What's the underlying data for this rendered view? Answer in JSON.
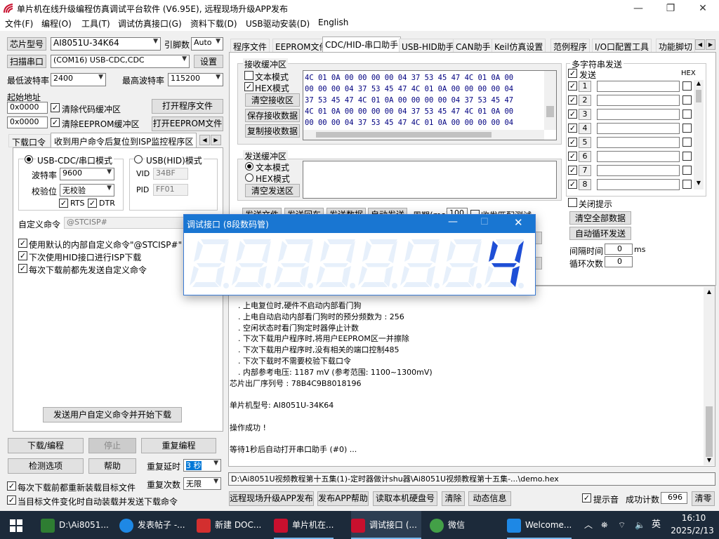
{
  "window": {
    "title": "单片机在线升级编程仿真调试平台软件 (V6.95E), 远程现场升级APP发布"
  },
  "menu": [
    "文件(F)",
    "编程(O)",
    "工具(T)",
    "调试仿真接口(G)",
    "资料下载(D)",
    "USB驱动安装(D)",
    "English"
  ],
  "left": {
    "chip_button": "芯片型号",
    "chip_value": "AI8051U-34K64",
    "pin_label": "引脚数",
    "pin_value": "Auto",
    "scan_button": "扫描串口",
    "port_value": "(COM16) USB-CDC,CDC",
    "settings_button": "设置",
    "min_baud_label": "最低波特率",
    "min_baud_value": "2400",
    "max_baud_label": "最高波特率",
    "max_baud_value": "115200",
    "start_addr_label": "起始地址",
    "addr1": "0x0000",
    "clear_code_label": "清除代码缓冲区",
    "open_prog_button": "打开程序文件",
    "addr2": "0x0000",
    "clear_eeprom_label": "清除EEPROM缓冲区",
    "open_eeprom_button": "打开EEPROM文件",
    "subtab1": "下载口令",
    "subtab2": "收到用户命令后复位到ISP监控程序区",
    "cdc_mode": "USB-CDC/串口模式",
    "hid_mode": "USB(HID)模式",
    "baud_label": "波特率",
    "baud_value": "9600",
    "parity_label": "校验位",
    "parity_value": "无校验",
    "rts_label": "RTS",
    "dtr_label": "DTR",
    "vid_label": "VID",
    "vid_value": "34BF",
    "pid_label": "PID",
    "pid_value": "FF01",
    "custom_cmd_label": "自定义命令",
    "custom_cmd_value": "@STCISP#",
    "opt1": "使用默认的内部自定义命令\"@STCISP#\"",
    "opt2": "下次使用HID接口进行ISP下载",
    "opt3": "每次下载前都先发送自定义命令",
    "send_custom_button": "发送用户自定义命令并开始下载",
    "download_button": "下载/编程",
    "stop_button": "停止",
    "reprogram_button": "重复编程",
    "check_button": "检测选项",
    "help_button": "帮助",
    "repeat_delay_label": "重复延时",
    "repeat_delay_value": "3 秒",
    "repeat_count_label": "重复次数",
    "repeat_count_value": "无限",
    "reload_label": "每次下载前都重新装载目标文件",
    "auto_label": "当目标文件变化时自动装载并发送下载命令"
  },
  "tabs": [
    "程序文件",
    "EEPROM文件",
    "CDC/HID-串口助手",
    "USB-HID助手",
    "CAN助手",
    "Keil仿真设置",
    "范例程序",
    "I/O口配置工具",
    "功能脚切"
  ],
  "receive": {
    "title": "接收缓冲区",
    "text_mode": "文本模式",
    "hex_mode": "HEX模式",
    "clear_button": "清空接收区",
    "save_button": "保存接收数据",
    "copy_button": "复制接收数据",
    "lines": [
      "4C 01 0A 00 00 00 00 04 37 53 45 47 4C 01 0A 00",
      "00 00 00 04 37 53 45 47 4C 01 0A 00 00 00 00 04",
      "37 53 45 47 4C 01 0A 00 00 00 00 04 37 53 45 47",
      "4C 01 0A 00 00 00 00 04 37 53 45 47 4C 01 0A 00",
      "00 00 00 04 37 53 45 47 4C 01 0A 00 00 00 00 04"
    ]
  },
  "send": {
    "title": "发送缓冲区",
    "text_mode": "文本模式",
    "hex_mode": "HEX模式",
    "clear_button": "清空发送区",
    "row_items": [
      "发送文件",
      "发送回车",
      "发送数据",
      "自动发送",
      "周期(ms)",
      "100",
      "收发匹配测试"
    ]
  },
  "multi": {
    "title": "多字符串发送",
    "send_label": "发送",
    "hex_label": "HEX",
    "rows": [
      "1",
      "2",
      "3",
      "4",
      "5",
      "6",
      "7",
      "8"
    ],
    "close_prompt": "关闭提示",
    "clear_all_button": "清空全部数据",
    "auto_loop_button": "自动循环发送",
    "interval_label": "间隔时间",
    "interval_value": "0",
    "interval_unit": "ms",
    "loop_label": "循环次数",
    "loop_value": "0"
  },
  "log": {
    "lines": [
      ". 上电复位时,硬件不启动内部看门狗",
      ". 上电自动启动内部看门狗时的预分频数为 : 256",
      ". 空闲状态时看门狗定时器停止计数",
      ". 下次下载用户程序时,将用户EEPROM区一并擦除",
      ". 下次下载用户程序时,没有相关的端口控制485",
      ". 下次下载时不需要校验下载口令",
      ". 内部参考电压: 1187 mV (参考范围: 1100~1300mV)",
      "芯片出厂序列号 : 78B4C9B8018196",
      "",
      "  单片机型号: AI8051U-34K64",
      "",
      "操作成功 !",
      "",
      "等待1秒后自动打开串口助手 (#0) ..."
    ]
  },
  "path": "D:\\Ai8051U视频教程第十五集(1)-定时器做计shu器\\Ai8051U视频教程第十五集-...\\demo.hex",
  "bottom": {
    "remote_button": "远程现场升级APP发布",
    "app_help_button": "发布APP帮助",
    "read_disk_button": "读取本机硬盘号",
    "clear_button": "清除",
    "anim_button": "动态信息",
    "sound_label": "提示音",
    "success_label": "成功计数",
    "success_value": "696",
    "clear2_button": "清零"
  },
  "popup": {
    "title": "调试接口 (8段数码管)",
    "digits": "4",
    "color_on": "#1f4fd6",
    "color_off": "#e7f0fb"
  },
  "taskbar": {
    "items": [
      "D:\\Ai8051...",
      "发表帖子 -...",
      "新建 DOC...",
      "单片机在...",
      "调试接口 (...",
      "微信",
      "Welcome..."
    ],
    "lang": "英",
    "time": "16:10",
    "date": "2025/2/13"
  }
}
